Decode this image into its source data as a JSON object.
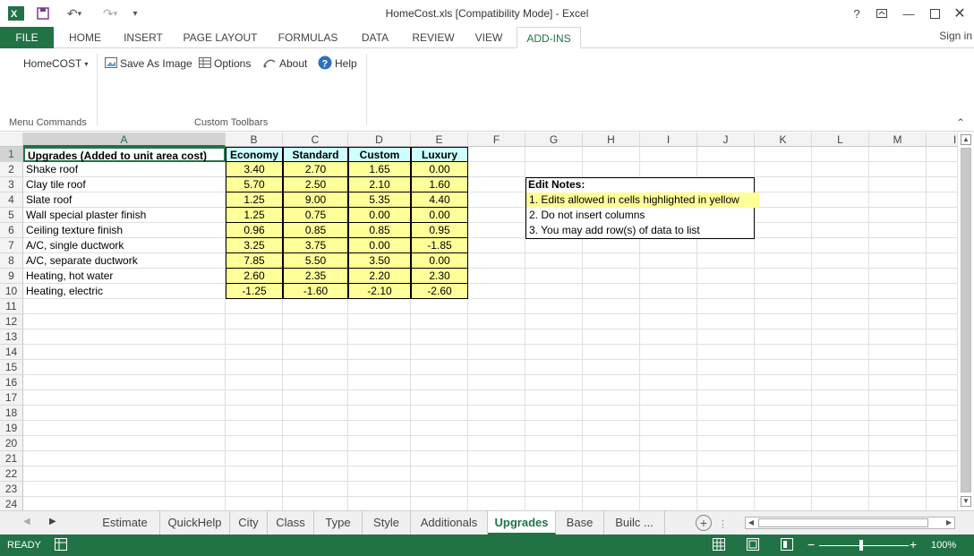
{
  "window": {
    "title": "HomeCost.xls  [Compatibility Mode] - Excel",
    "help": "?",
    "sign_in": "Sign in"
  },
  "ribbon_tabs": [
    "FILE",
    "HOME",
    "INSERT",
    "PAGE LAYOUT",
    "FORMULAS",
    "DATA",
    "REVIEW",
    "VIEW",
    "ADD-INS"
  ],
  "ribbon": {
    "homecost_menu": "HomeCOST",
    "save_as_image": "Save As Image",
    "options": "Options",
    "about": "About",
    "help": "Help",
    "group_menu_commands": "Menu Commands",
    "group_custom_toolbars": "Custom Toolbars"
  },
  "columns": [
    "A",
    "B",
    "C",
    "D",
    "E",
    "F",
    "G",
    "H",
    "I",
    "J",
    "K",
    "L",
    "M",
    "I"
  ],
  "rows": [
    "1",
    "2",
    "3",
    "4",
    "5",
    "6",
    "7",
    "8",
    "9",
    "10",
    "11",
    "12",
    "13",
    "14",
    "15",
    "16",
    "17",
    "18",
    "19",
    "20",
    "21",
    "22",
    "23",
    "24"
  ],
  "table": {
    "header": [
      "Upgrades (Added to unit area cost)",
      "Economy",
      "Standard",
      "Custom",
      "Luxury"
    ],
    "rows": [
      [
        "Shake roof",
        "3.40",
        "2.70",
        "1.65",
        "0.00"
      ],
      [
        "Clay tile roof",
        "5.70",
        "2.50",
        "2.10",
        "1.60"
      ],
      [
        "Slate roof",
        "1.25",
        "9.00",
        "5.35",
        "4.40"
      ],
      [
        "Wall special plaster finish",
        "1.25",
        "0.75",
        "0.00",
        "0.00"
      ],
      [
        "Ceiling texture finish",
        "0.96",
        "0.85",
        "0.85",
        "0.95"
      ],
      [
        "A/C, single ductwork",
        "3.25",
        "3.75",
        "0.00",
        "-1.85"
      ],
      [
        "A/C, separate ductwork",
        "7.85",
        "5.50",
        "3.50",
        "0.00"
      ],
      [
        "Heating, hot water",
        "2.60",
        "2.35",
        "2.20",
        "2.30"
      ],
      [
        "Heating, electric",
        "-1.25",
        "-1.60",
        "-2.10",
        "-2.60"
      ]
    ]
  },
  "notes": {
    "title": "Edit Notes:",
    "lines": [
      "1. Edits allowed in cells highlighted in yellow",
      "2. Do not insert columns",
      "3. You may add row(s) of data to list"
    ]
  },
  "sheet_tabs": [
    "Estimate",
    "QuickHelp",
    "City",
    "Class",
    "Type",
    "Style",
    "Additionals",
    "Upgrades",
    "Base",
    "Builc ..."
  ],
  "active_sheet": "Upgrades",
  "status": {
    "ready": "READY",
    "zoom": "100%"
  },
  "colors": {
    "accent": "#217346",
    "yellow": "#ffff99",
    "cyan": "#ccffff"
  }
}
